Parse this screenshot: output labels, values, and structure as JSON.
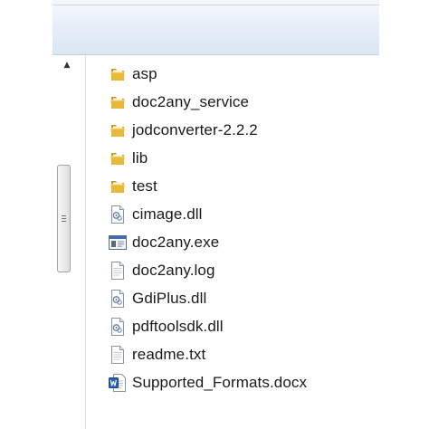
{
  "scrollbar": {
    "up_arrow": "▲",
    "position": 0.35
  },
  "files": [
    {
      "name": "asp",
      "type": "folder",
      "icon": "folder-icon"
    },
    {
      "name": "doc2any_service",
      "type": "folder",
      "icon": "folder-icon"
    },
    {
      "name": "jodconverter-2.2.2",
      "type": "folder",
      "icon": "folder-icon"
    },
    {
      "name": "lib",
      "type": "folder",
      "icon": "folder-icon"
    },
    {
      "name": "test",
      "type": "folder",
      "icon": "folder-icon"
    },
    {
      "name": "cimage.dll",
      "type": "dll",
      "icon": "dll-file-icon"
    },
    {
      "name": "doc2any.exe",
      "type": "exe",
      "icon": "exe-file-icon"
    },
    {
      "name": "doc2any.log",
      "type": "text",
      "icon": "text-file-icon"
    },
    {
      "name": "GdiPlus.dll",
      "type": "dll",
      "icon": "dll-file-icon"
    },
    {
      "name": "pdftoolsdk.dll",
      "type": "dll",
      "icon": "dll-file-icon"
    },
    {
      "name": "readme.txt",
      "type": "text",
      "icon": "text-file-icon"
    },
    {
      "name": "Supported_Formats.docx",
      "type": "docx",
      "icon": "word-document-icon"
    }
  ],
  "colors": {
    "folder": "#e9b93a",
    "folder_dark": "#c8941f",
    "toolbar": "#dbe6f4",
    "word_blue": "#2b5fb4"
  }
}
